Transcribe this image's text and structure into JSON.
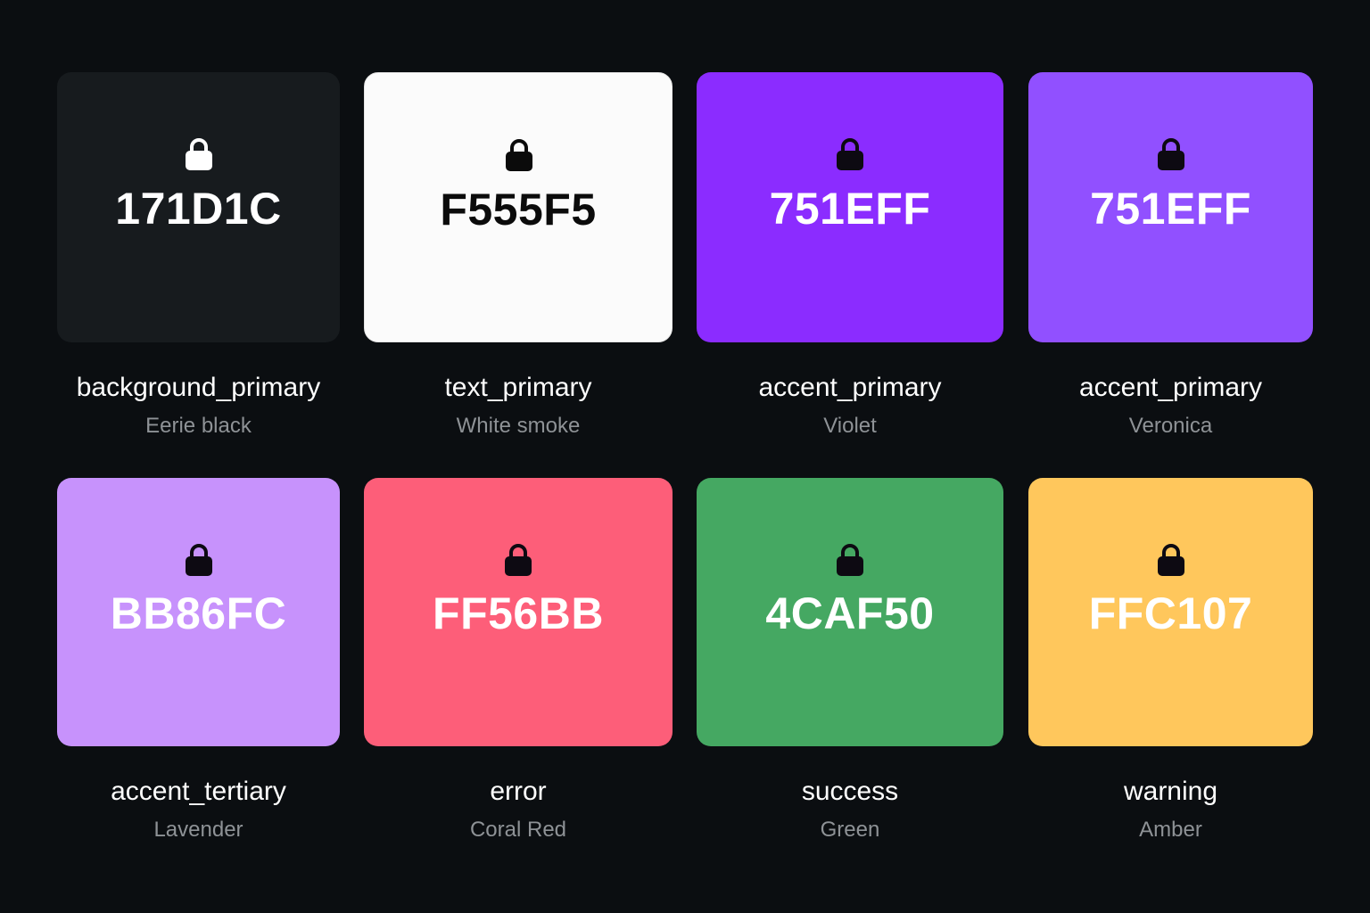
{
  "swatches": [
    {
      "hex": "171D1C",
      "role": "background_primary",
      "name": "Eerie black",
      "color": "#171b1e",
      "hex_text_color": "#ffffff",
      "lock_color": "#ffffff"
    },
    {
      "hex": "F555F5",
      "role": "text_primary",
      "name": "White smoke",
      "color": "#fbfbfb",
      "hex_text_color": "#0b0b0b",
      "lock_color": "#0b0b0b"
    },
    {
      "hex": "751EFF",
      "role": "accent_primary",
      "name": "Violet",
      "color": "#8b2cff",
      "hex_text_color": "#ffffff",
      "lock_color": "#0d0a12"
    },
    {
      "hex": "751EFF",
      "role": "accent_primary",
      "name": "Veronica",
      "color": "#9150ff",
      "hex_text_color": "#ffffff",
      "lock_color": "#0d0a12"
    },
    {
      "hex": "BB86FC",
      "role": "accent_tertiary",
      "name": "Lavender",
      "color": "#c792fc",
      "hex_text_color": "#ffffff",
      "lock_color": "#0d0a12"
    },
    {
      "hex": "FF56BB",
      "role": "error",
      "name": "Coral Red",
      "color": "#fd5e79",
      "hex_text_color": "#ffffff",
      "lock_color": "#0d0a12"
    },
    {
      "hex": "4CAF50",
      "role": "success",
      "name": "Green",
      "color": "#45a862",
      "hex_text_color": "#ffffff",
      "lock_color": "#0d0a12"
    },
    {
      "hex": "FFC107",
      "role": "warning",
      "name": "Amber",
      "color": "#ffc75c",
      "hex_text_color": "#ffffff",
      "lock_color": "#0d0a12"
    }
  ],
  "icons": {
    "lock": "lock-icon"
  }
}
